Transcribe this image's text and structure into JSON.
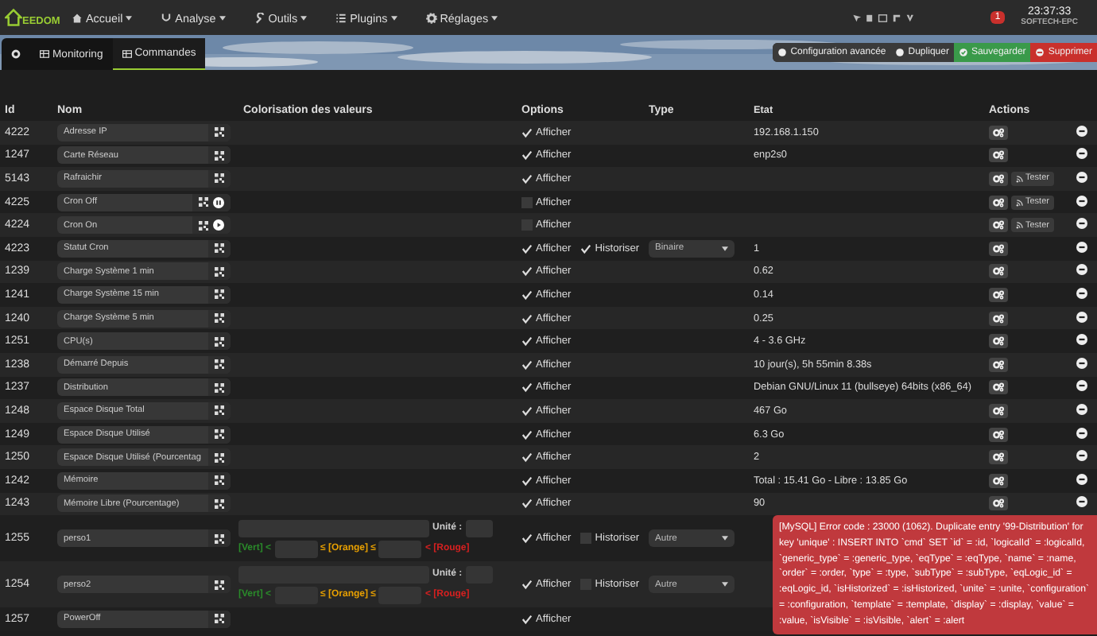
{
  "navbar": {
    "logo": "EEDOM",
    "menus": [
      {
        "label": "Accueil"
      },
      {
        "label": "Analyse"
      },
      {
        "label": "Outils"
      },
      {
        "label": "Plugins"
      },
      {
        "label": "Réglages"
      }
    ],
    "notification_count": "1",
    "time": "23:37:33",
    "host": "SOFTECH-EPC"
  },
  "tabs": [
    {
      "kind": "icon",
      "selected": false
    },
    {
      "kind": "text",
      "label": "Monitoring",
      "selected": false
    },
    {
      "kind": "text",
      "label": "Commandes",
      "selected": true
    }
  ],
  "toolbar": [
    {
      "kind": "default",
      "label": "Configuration avancée"
    },
    {
      "kind": "default",
      "label": "Dupliquer"
    },
    {
      "kind": "success",
      "label": "Sauvegarder"
    },
    {
      "kind": "danger",
      "label": "Supprimer"
    }
  ],
  "table": {
    "columns": [
      "Id",
      "Nom",
      "Colorisation des valeurs",
      "Options",
      "Type",
      "Etat",
      "Actions"
    ],
    "rows": [
      {
        "kind": "info",
        "id": "4222",
        "name": "Adresse IP",
        "visible": {
          "label": "Afficher",
          "checked": true
        },
        "etat": "192.168.1.150"
      },
      {
        "kind": "info",
        "id": "1247",
        "name": "Carte Réseau",
        "visible": {
          "label": "Afficher",
          "checked": true
        },
        "etat": "enp2s0"
      },
      {
        "kind": "action",
        "id": "5143",
        "name": "Rafraichir",
        "visible": {
          "label": "Afficher",
          "checked": true
        },
        "tester": "Tester"
      },
      {
        "kind": "pause",
        "id": "4225",
        "name": "Cron Off",
        "visible": {
          "label": "Afficher",
          "checked": false
        },
        "tester": "Tester"
      },
      {
        "kind": "play",
        "id": "4224",
        "name": "Cron On",
        "visible": {
          "label": "Afficher",
          "checked": false
        },
        "tester": "Tester"
      },
      {
        "kind": "info",
        "id": "4223",
        "name": "Statut Cron",
        "visible": {
          "label": "Afficher",
          "checked": true
        },
        "historize": {
          "label": "Historiser",
          "checked": true
        },
        "type": "Binaire",
        "etat": "1"
      },
      {
        "kind": "info",
        "id": "1239",
        "name": "Charge Système 1 min",
        "visible": {
          "label": "Afficher",
          "checked": true
        },
        "etat": "0.62"
      },
      {
        "kind": "info",
        "id": "1241",
        "name": "Charge Système 15 min",
        "visible": {
          "label": "Afficher",
          "checked": true
        },
        "etat": "0.14"
      },
      {
        "kind": "info",
        "id": "1240",
        "name": "Charge Système 5 min",
        "visible": {
          "label": "Afficher",
          "checked": true
        },
        "etat": "0.25"
      },
      {
        "kind": "info",
        "id": "1251",
        "name": "CPU(s)",
        "visible": {
          "label": "Afficher",
          "checked": true
        },
        "etat": "4 - 3.6 GHz"
      },
      {
        "kind": "info",
        "id": "1238",
        "name": "Démarré Depuis",
        "visible": {
          "label": "Afficher",
          "checked": true
        },
        "etat": "10 jour(s), 5h 55min 8.38s"
      },
      {
        "kind": "info",
        "id": "1237",
        "name": "Distribution",
        "visible": {
          "label": "Afficher",
          "checked": true
        },
        "etat": "Debian GNU/Linux 11 (bullseye) 64bits (x86_64)"
      },
      {
        "kind": "info",
        "id": "1248",
        "name": "Espace Disque Total",
        "visible": {
          "label": "Afficher",
          "checked": true
        },
        "etat": "467 Go"
      },
      {
        "kind": "info",
        "id": "1249",
        "name": "Espace Disque Utilisé",
        "visible": {
          "label": "Afficher",
          "checked": true
        },
        "etat": "6.3 Go"
      },
      {
        "kind": "info",
        "id": "1250",
        "name": "Espace Disque Utilisé (Pourcentag",
        "visible": {
          "label": "Afficher",
          "checked": true
        },
        "etat": "2"
      },
      {
        "kind": "info",
        "id": "1242",
        "name": "Mémoire",
        "visible": {
          "label": "Afficher",
          "checked": true
        },
        "etat": "Total : 15.41 Go - Libre : 13.85 Go"
      },
      {
        "kind": "info",
        "id": "1243",
        "name": "Mémoire Libre (Pourcentage)",
        "visible": {
          "label": "Afficher",
          "checked": true
        },
        "etat": "90"
      },
      {
        "kind": "info",
        "id": "1255",
        "name": "perso1",
        "visible": {
          "label": "Afficher",
          "checked": true
        },
        "historize": {
          "label": "Historiser",
          "checked": false
        },
        "type": "Autre",
        "colorisation": {
          "unit_label": "Unité :",
          "green": "[Vert] <",
          "orange": "≤ [Orange] ≤",
          "red": "< [Rouge]"
        }
      },
      {
        "kind": "info",
        "id": "1254",
        "name": "perso2",
        "visible": {
          "label": "Afficher",
          "checked": true
        },
        "historize": {
          "label": "Historiser",
          "checked": false
        },
        "type": "Autre",
        "colorisation": {
          "unit_label": "Unité :",
          "green": "[Vert] <",
          "orange": "≤ [Orange] ≤",
          "red": "< [Rouge]"
        }
      },
      {
        "kind": "info",
        "id": "1257",
        "name": "PowerOff",
        "visible": {
          "label": "Afficher",
          "checked": true
        },
        "covered": true
      }
    ]
  },
  "alert": {
    "text": "[MySQL] Error code : 23000 (1062). Duplicate entry '99-Distribution' for key 'unique' : INSERT INTO `cmd` SET `id` = :id, `logicalId` = :logicalId, `generic_type` = :generic_type, `eqType` = :eqType, `name` = :name, `order` = :order, `type` = :type, `subType` = :subType, `eqLogic_id` = :eqLogic_id, `isHistorized` = :isHistorized, `unite` = :unite, `configuration` = :configuration, `template` = :template, `display` = :display, `value` = :value, `isVisible` = :isVisible, `alert` = :alert"
  }
}
